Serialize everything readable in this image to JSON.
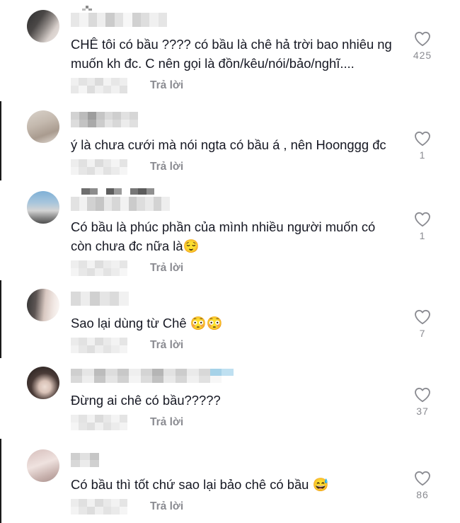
{
  "colors": {
    "text": "#161823",
    "secondary": "#8a8b91",
    "background": "#ffffff",
    "edge_line": "#1a1a1a"
  },
  "icons": {
    "like": "heart-outline-icon"
  },
  "comments": [
    {
      "text_lines": [
        "CHÊ tôi có bầu ???? có bầu là chê hả trời bao nhiêu ng",
        "muốn kh đc. C nên gọi là đồn/kêu/nói/bảo/nghĩ...."
      ],
      "reply_label": "Trả lời",
      "likes": 425
    },
    {
      "text_lines": [
        "ý là chưa cưới mà nói ngta có bầu á , nên Hoonggg đc"
      ],
      "reply_label": "Trả lời",
      "likes": 1
    },
    {
      "text_lines": [
        "Có bầu là phúc phần của mình nhiều người muốn có",
        "còn chưa đc nữa là😌"
      ],
      "reply_label": "Trả lời",
      "likes": 1
    },
    {
      "text_lines": [
        "Sao lại dùng từ Chê 😳😳"
      ],
      "reply_label": "Trả lời",
      "likes": 7
    },
    {
      "text_lines": [
        "Đừng ai chê có bầu?????"
      ],
      "reply_label": "Trả lời",
      "likes": 37
    },
    {
      "text_lines": [
        "Có bầu thì tốt chứ sao lại bảo chê có bầu 😅"
      ],
      "reply_label": "Trả lời",
      "likes": 86
    }
  ]
}
